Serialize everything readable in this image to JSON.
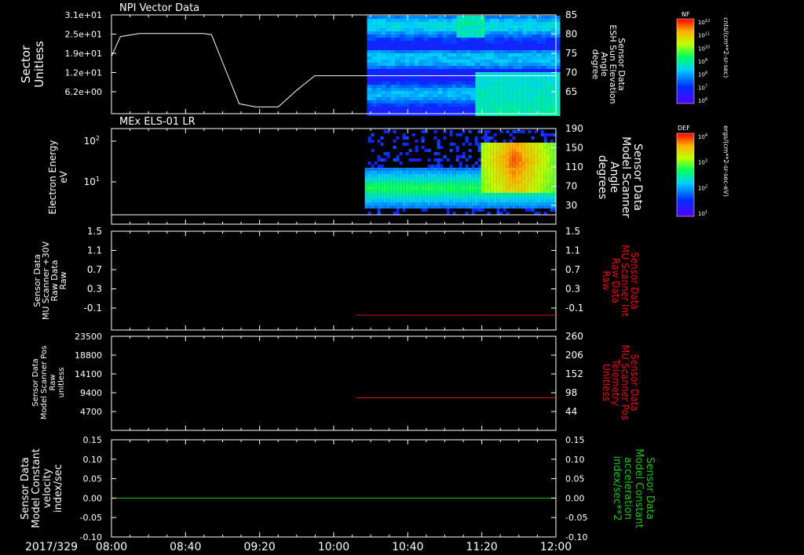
{
  "date_label": "2017/329",
  "time_ticks": [
    "08:00",
    "08:40",
    "09:20",
    "10:00",
    "10:40",
    "11:20",
    "12:00"
  ],
  "colorbars": [
    {
      "label": "NF",
      "units": "cnts/(cm**2-sr-sec)",
      "tick_labels": [
        "10^12",
        "10^11",
        "10^10",
        "10^9",
        "10^8",
        "10^7",
        "10^6"
      ]
    },
    {
      "label": "DEF",
      "units": "ergs/(cm**2-sr-sec-eV)",
      "tick_labels": [
        "10^4",
        "10^3",
        "10^2",
        "10^1"
      ]
    }
  ],
  "colors": {
    "white": "#ffffff",
    "red": "#e01010",
    "green": "#20c020",
    "background": "#000000"
  },
  "chart_data": [
    {
      "type": "line",
      "title": "NPI Vector Data",
      "ylabel_left": [
        "Sector",
        "Unitless"
      ],
      "ylabel_right": [
        "Sensor Data",
        "ESH Sun Elevation",
        "Angle",
        "degree"
      ],
      "yticks_left": [
        "3.1e+01",
        "2.5e+01",
        "1.9e+01",
        "1.2e+01",
        "6.2e+00"
      ],
      "yticks_right": [
        "85",
        "80",
        "75",
        "70",
        "65"
      ],
      "ylim_right": [
        60,
        85
      ],
      "x_hours": [
        8.0,
        8.08,
        8.25,
        8.5,
        8.83,
        8.9,
        9.0,
        9.15,
        9.3,
        9.5,
        9.67,
        9.83,
        10.0,
        10.25,
        10.5,
        10.75,
        11.0,
        11.5,
        12.0
      ],
      "y_right": [
        74.5,
        79.5,
        80.3,
        80.3,
        80.3,
        80.0,
        73.0,
        62.5,
        61.7,
        61.7,
        66.0,
        69.6,
        69.6,
        69.6,
        69.6,
        69.6,
        69.6,
        69.6,
        69.6
      ],
      "spectrogram_start_hours": 10.3,
      "colorbar": "NF"
    },
    {
      "type": "line",
      "title": "MEx ELS-01 LR",
      "ylabel_left": [
        "Electron Energy",
        "eV"
      ],
      "ylabel_right": [
        "Sensor Data",
        "Model Scanner",
        "Angle",
        "degrees"
      ],
      "yticks_left": [
        "10^2",
        "10^1"
      ],
      "yticks_right": [
        "190",
        "150",
        "110",
        "70",
        "30"
      ],
      "ylim_right": [
        0,
        190
      ],
      "x_hours": [
        8.0,
        12.0
      ],
      "y_right": [
        0,
        0
      ],
      "spectrogram_start_hours": 10.28,
      "colorbar": "DEF"
    },
    {
      "type": "line",
      "ylabel_left": [
        "Sensor Data",
        "MU Scanner +30V",
        "Raw Data",
        "Raw"
      ],
      "ylabel_right": [
        "Sensor Data",
        "MU Scanner Int",
        "Raw Data",
        "Raw"
      ],
      "yticks_left": [
        "1.5",
        "1.1",
        "0.7",
        "0.3",
        "-0.1"
      ],
      "yticks_right": [
        "1.5",
        "1.1",
        "0.7",
        "0.3",
        "-0.1"
      ],
      "ylim": [
        -0.3,
        1.5
      ],
      "series": [
        {
          "color": "red",
          "x_hours": [
            10.2,
            12.0
          ],
          "y": [
            -0.03,
            -0.03
          ]
        }
      ]
    },
    {
      "type": "line",
      "ylabel_left": [
        "Sensor Data",
        "Model Scanner Pos",
        "Raw",
        "unitless"
      ],
      "ylabel_right": [
        "Sensor Data",
        "MU Scanner Pos",
        "Telemetry",
        "Unitless"
      ],
      "yticks_left": [
        "23500",
        "18800",
        "14100",
        "9400",
        "4700"
      ],
      "yticks_right": [
        "260",
        "206",
        "152",
        "98",
        "44"
      ],
      "ylim_right": [
        0,
        260
      ],
      "series": [
        {
          "color": "red",
          "x_hours": [
            10.2,
            12.0
          ],
          "y_right": [
            90,
            90
          ]
        }
      ]
    },
    {
      "type": "line",
      "ylabel_left": [
        "Sensor Data",
        "Model Constant",
        "velocity",
        "index/sec"
      ],
      "ylabel_right": [
        "Sensor Data",
        "Model Constant",
        "acceleration",
        "index/sec**2"
      ],
      "yticks_left": [
        "0.15",
        "0.10",
        "0.05",
        "0.00",
        "-0.05",
        "-0.10"
      ],
      "yticks_right": [
        "0.15",
        "0.10",
        "0.05",
        "0.00",
        "-0.05",
        "-0.10"
      ],
      "ylim": [
        -0.1,
        0.15
      ],
      "series": [
        {
          "color": "green",
          "x_hours": [
            8.0,
            12.0
          ],
          "y": [
            0.0,
            0.0
          ]
        }
      ]
    }
  ]
}
